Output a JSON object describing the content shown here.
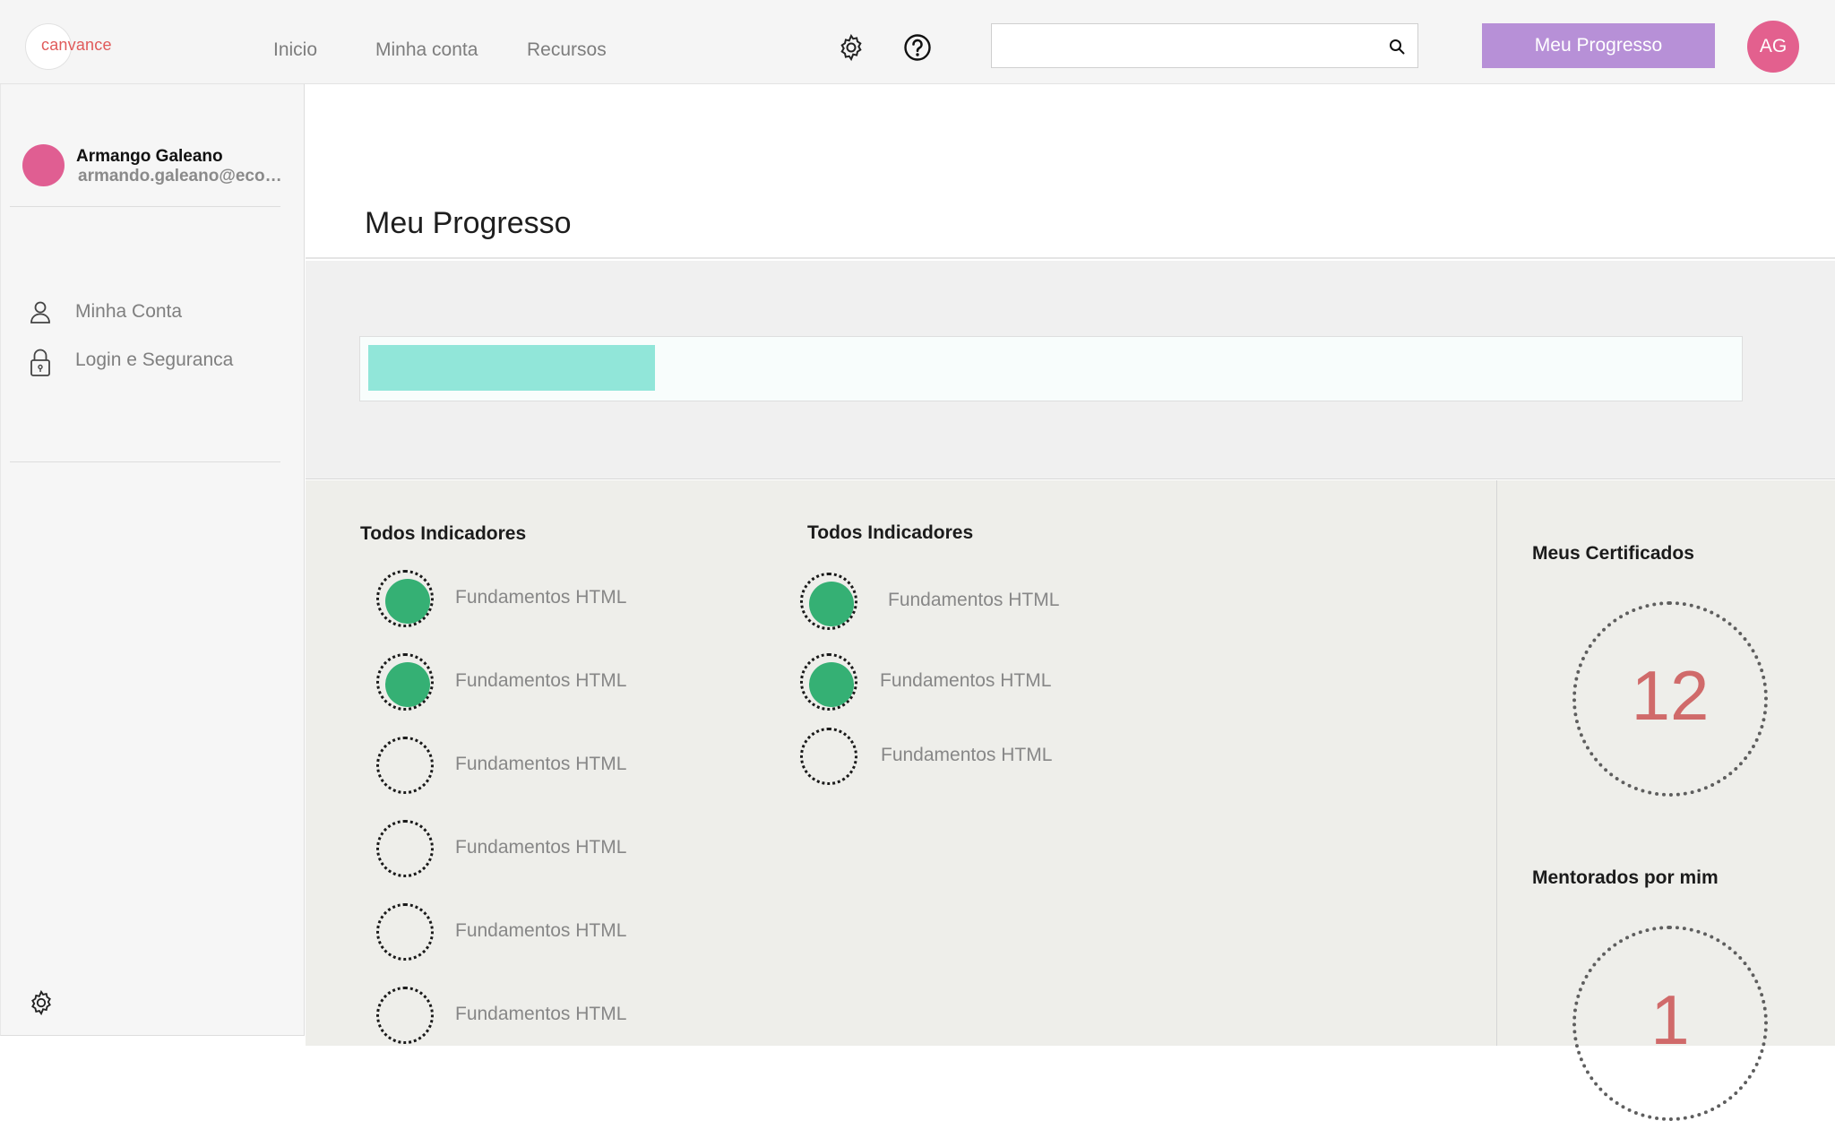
{
  "header": {
    "logo_text": "canvance",
    "nav": [
      "Inicio",
      "Minha conta",
      "Recursos"
    ],
    "settings_icon": "gear-icon",
    "help_icon": "question-circle-icon",
    "search": {
      "value": "",
      "placeholder": "",
      "icon": "search-icon"
    },
    "primary_button_label": "Meu Progresso",
    "avatar_initials": "AG",
    "colors": {
      "primary_button": "#b790d7",
      "avatar": "#e3608e",
      "logo": "#e05a5a"
    }
  },
  "sidebar": {
    "user": {
      "name": "Armango Galeano",
      "email": "armando.galeano@econ..."
    },
    "items": [
      {
        "label": "Minha Conta",
        "icon": "user-icon"
      },
      {
        "label": "Login e Seguranca",
        "icon": "lock-icon"
      }
    ],
    "footer_icon": "gear-icon"
  },
  "main": {
    "title": "Meu Progresso",
    "progress": {
      "fraction": 0.21,
      "fill_color": "#91e6d9"
    },
    "indicators_left": {
      "heading": "Todos Indicadores",
      "items": [
        {
          "label": "Fundamentos HTML",
          "completed": true
        },
        {
          "label": "Fundamentos HTML",
          "completed": true
        },
        {
          "label": "Fundamentos HTML",
          "completed": false
        },
        {
          "label": "Fundamentos HTML",
          "completed": false
        },
        {
          "label": "Fundamentos HTML",
          "completed": false
        },
        {
          "label": "Fundamentos HTML",
          "completed": false
        }
      ]
    },
    "indicators_right": {
      "heading": "Todos Indicadores",
      "items": [
        {
          "label": "Fundamentos HTML",
          "completed": true
        },
        {
          "label": "Fundamentos HTML",
          "completed": true
        },
        {
          "label": "Fundamentos HTML",
          "completed": false
        }
      ]
    },
    "stats": {
      "certificates": {
        "heading": "Meus Certificados",
        "value": "12"
      },
      "mentored": {
        "heading": "Mentorados por mim",
        "value": "1"
      }
    },
    "colors": {
      "completed_dot": "#35b074",
      "stat_number": "#d06a6a"
    }
  }
}
